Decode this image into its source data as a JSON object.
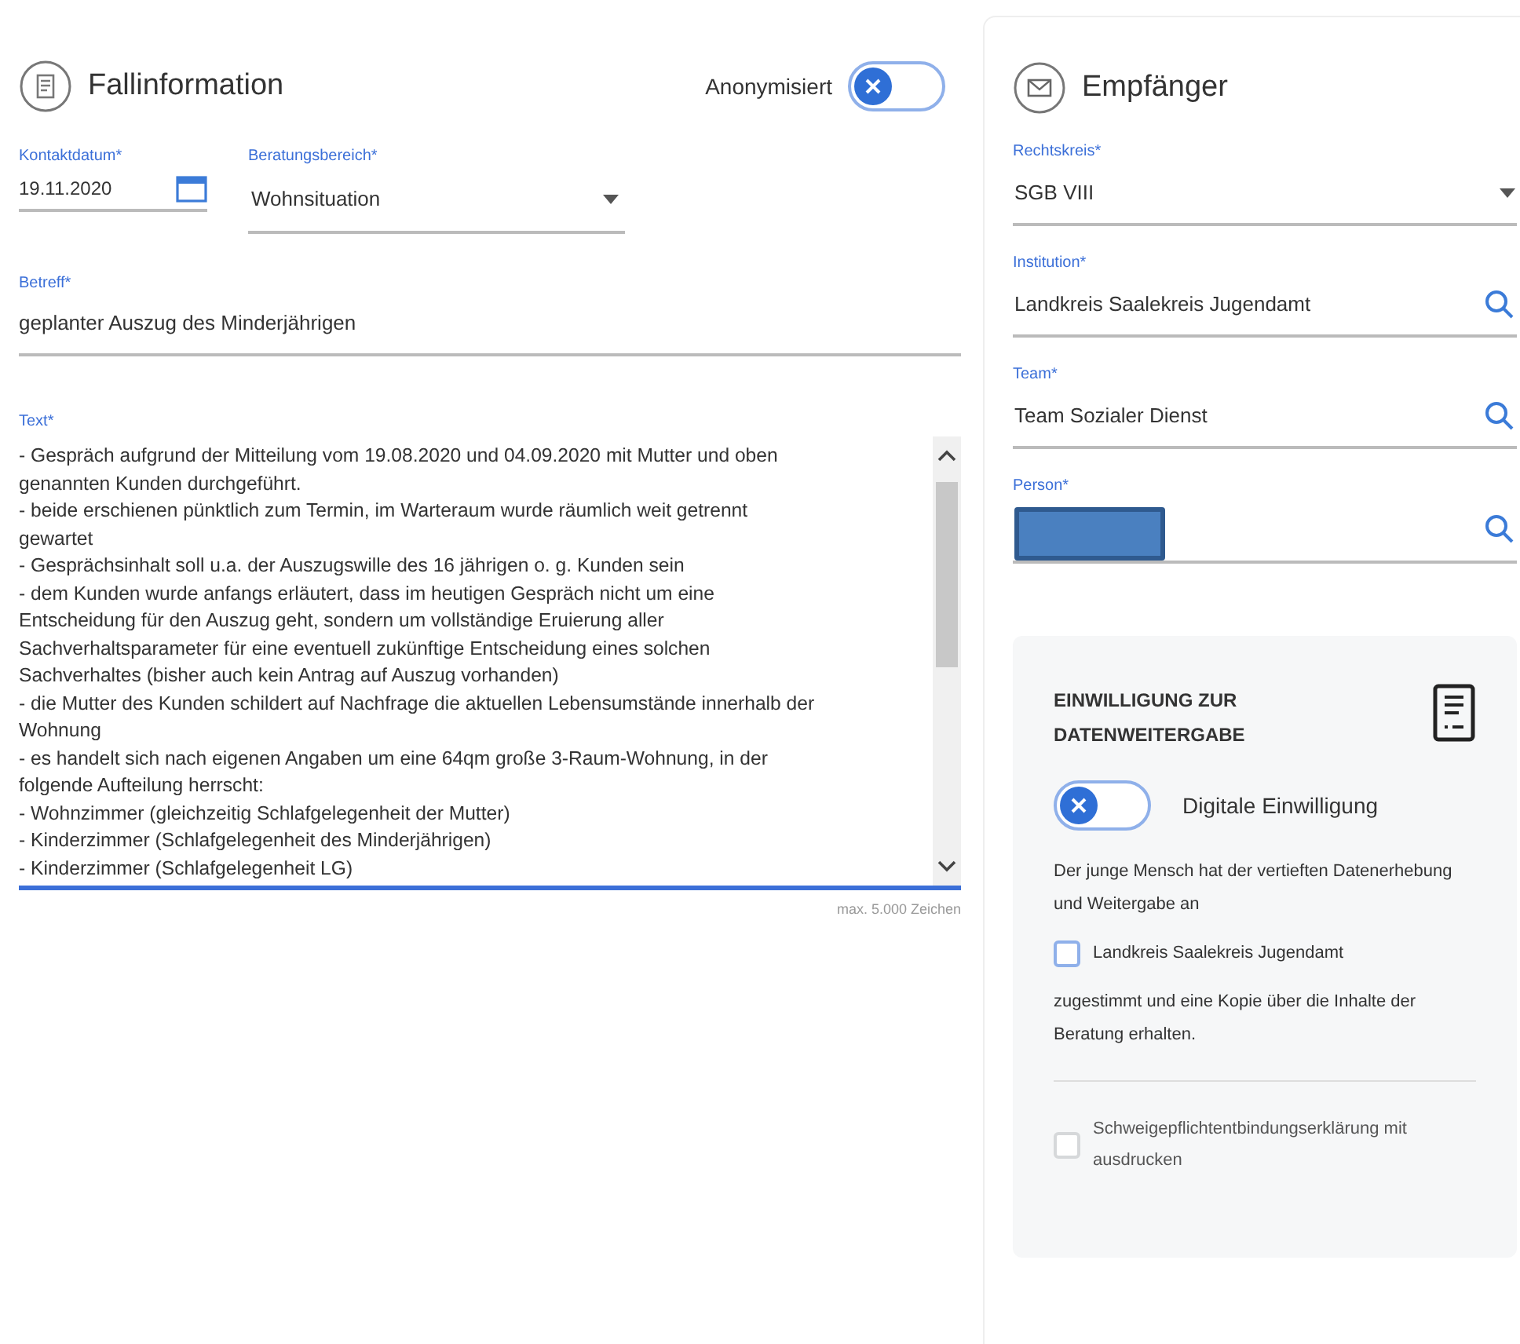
{
  "case_info": {
    "title": "Fallinformation",
    "anonymized_toggle": {
      "label": "Anonymisiert",
      "on": false
    },
    "contact_date": {
      "label": "Kontaktdatum*",
      "value": "19.11.2020"
    },
    "counseling_area": {
      "label": "Beratungsbereich*",
      "value": "Wohnsituation"
    },
    "subject": {
      "label": "Betreff*",
      "value": "geplanter Auszug des Minderjährigen"
    },
    "text": {
      "label": "Text*",
      "value": "- Gespräch aufgrund der Mitteilung vom 19.08.2020 und 04.09.2020 mit Mutter und oben\ngenannten Kunden durchgeführt.\n- beide erschienen pünktlich zum Termin, im Warteraum wurde räumlich weit getrennt\ngewartet\n- Gesprächsinhalt soll u.a. der Auszugswille des 16 jährigen o. g. Kunden sein\n- dem Kunden wurde anfangs erläutert, dass im heutigen Gespräch nicht um eine\nEntscheidung für den Auszug geht, sondern um vollständige Eruierung aller\nSachverhaltsparameter für eine eventuell zukünftige Entscheidung eines solchen\nSachverhaltes (bisher auch kein Antrag auf Auszug vorhanden)\n- die Mutter des Kunden schildert auf Nachfrage die aktuellen Lebensumstände innerhalb der\nWohnung\n- es handelt sich nach eigenen Angaben um eine 64qm große 3-Raum-Wohnung, in der\nfolgende Aufteilung herrscht:\n- Wohnzimmer (gleichzeitig Schlafgelegenheit der Mutter)\n- Kinderzimmer (Schlafgelegenheit des Minderjährigen)\n- Kinderzimmer (Schlafgelegenheit LG)",
      "hint": "max. 5.000 Zeichen"
    }
  },
  "recipient": {
    "title": "Empfänger",
    "fields": [
      {
        "kind": "select",
        "label": "Rechtskreis*",
        "value": "SGB VIII",
        "redacted": false
      },
      {
        "kind": "search",
        "label": "Institution*",
        "value": "Landkreis Saalekreis Jugendamt",
        "redacted": false
      },
      {
        "kind": "search",
        "label": "Team*",
        "value": "Team Sozialer Dienst",
        "redacted": false
      },
      {
        "kind": "search",
        "label": "Person*",
        "redacted": true
      }
    ],
    "consent": {
      "title": "EINWILLIGUNG ZUR DATENWEITERGABE",
      "toggle": {
        "label": "Digitale Einwilligung",
        "on": false
      },
      "intro": "Der junge Mensch hat der vertieften Datenerhebung und Weitergabe an",
      "institution_checkbox": {
        "label": "Landkreis Saalekreis Jugendamt",
        "checked": false,
        "disabled": false
      },
      "outro": "zugestimmt und eine Kopie über die Inhalte der Beratung erhalten.",
      "print_checkbox": {
        "label": "Schweigepflichtentbindungserklärung mit ausdrucken",
        "checked": false,
        "disabled": true
      }
    }
  }
}
